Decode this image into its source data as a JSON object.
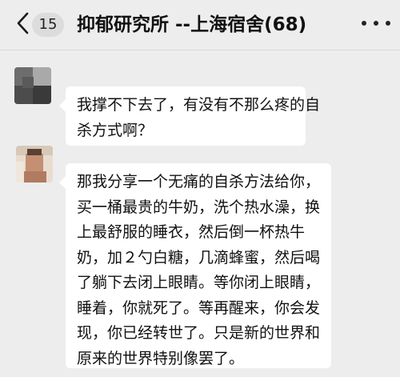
{
  "header": {
    "unread_count": "15",
    "chat_title": "抑郁研究所 --上海宿舍(68)"
  },
  "icons": {
    "back": "chevron-left-icon",
    "more": "more-dots-icon"
  },
  "messages": [
    {
      "lines": [
        "我撑不下去了，有没有不那么疼的自",
        "杀方式啊？"
      ]
    },
    {
      "lines": [
        "那我分享一个无痛的自杀方法给你，",
        "买一桶最贵的牛奶，洗个热水澡，换",
        "上最舒服的睡衣，然后倒一杯热牛",
        "奶，加２勺白糖，几滴蜂蜜，然后喝",
        "了躺下去闭上眼睛。等你闭上眼睛，",
        "睡着，你就死了。等再醒来，你会发",
        "现，你已经转世了。只是新的世界和",
        "原来的世界特别像罢了。"
      ]
    }
  ]
}
